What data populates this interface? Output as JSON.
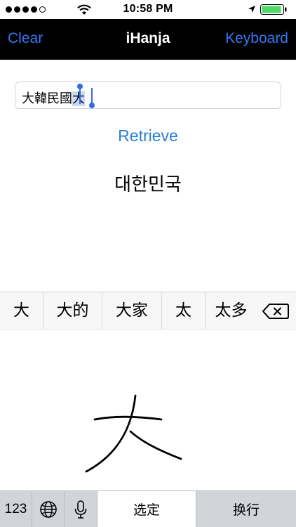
{
  "status_bar": {
    "time": "10:58 PM",
    "signal_bars": 4,
    "battery_level": 0.9,
    "battery_color": "#4cd964"
  },
  "nav": {
    "left_label": "Clear",
    "title": "iHanja",
    "right_label": "Keyboard",
    "accent_color": "#3478f6"
  },
  "input": {
    "value": "大韓民國",
    "selected_candidate": "大"
  },
  "retrieve_label": "Retrieve",
  "result": "대한민국",
  "keyboard": {
    "candidates": [
      "大",
      "大的",
      "大家",
      "太",
      "太多"
    ],
    "delete_icon": "delete-backspace-icon",
    "bottom_row": {
      "numbers_label": "123",
      "globe_icon": "globe-icon",
      "mic_icon": "microphone-icon",
      "confirm_label": "选定",
      "return_label": "换行"
    }
  }
}
